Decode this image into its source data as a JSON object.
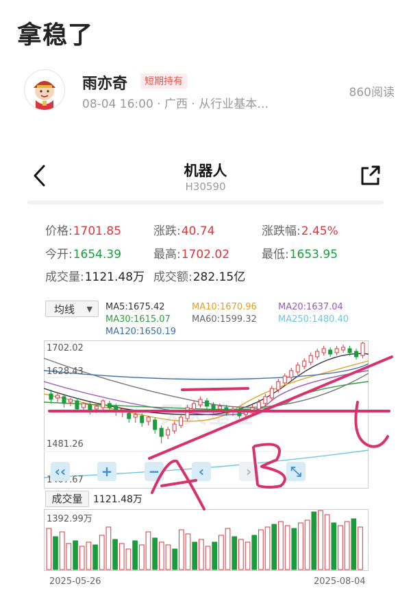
{
  "post": {
    "title": "拿稳了",
    "author": "雨亦奇",
    "badge": "短期持有",
    "meta": "08-04 16:00 · 广西 · 从行业基本…",
    "reads": "860阅读"
  },
  "stock": {
    "name": "机器人",
    "code": "H30590",
    "quotes": {
      "price_label": "价格:",
      "price": "1701.85",
      "change_label": "涨跌:",
      "change": "40.74",
      "pct_label": "涨跌幅:",
      "pct": "2.45%",
      "open_label": "今开:",
      "open": "1654.39",
      "high_label": "最高:",
      "high": "1702.02",
      "low_label": "最低:",
      "low": "1653.95",
      "vol_label": "成交量:",
      "vol": "1121.48万",
      "amt_label": "成交额:",
      "amt": "282.15亿"
    },
    "ma_button": "均线",
    "ma": {
      "ma5": "MA5:1675.42",
      "ma10": "MA10:1670.96",
      "ma20": "MA20:1637.04",
      "ma30": "MA30:1615.07",
      "ma60": "MA60:1599.32",
      "ma250": "MA250:1480.40",
      "ma120": "MA120:1650.19"
    },
    "price_axis": {
      "top": "1702.02",
      "mid": "1628.43",
      "low": "1481.26",
      "bottom": "1407.67"
    },
    "controls": {
      "rewind": "‹‹",
      "zoom_in": "+",
      "zoom_out": "−",
      "prev": "‹",
      "next": "›",
      "expand": "⤡"
    },
    "volume_button": "成交量",
    "volume_value": "1121.48万",
    "volume_max": "1392.99万",
    "date_start": "2025-05-26",
    "date_end": "2025-08-04",
    "watermark": "天天基金"
  },
  "annotations": {
    "a": "A",
    "b": "B",
    "c": "C"
  },
  "colors": {
    "up": "#d9363e",
    "down": "#1a9b3c",
    "pen": "#d6336c",
    "accent": "#3b8fd0"
  },
  "icons": {
    "back": "chevron-left-icon",
    "share": "share-icon"
  }
}
